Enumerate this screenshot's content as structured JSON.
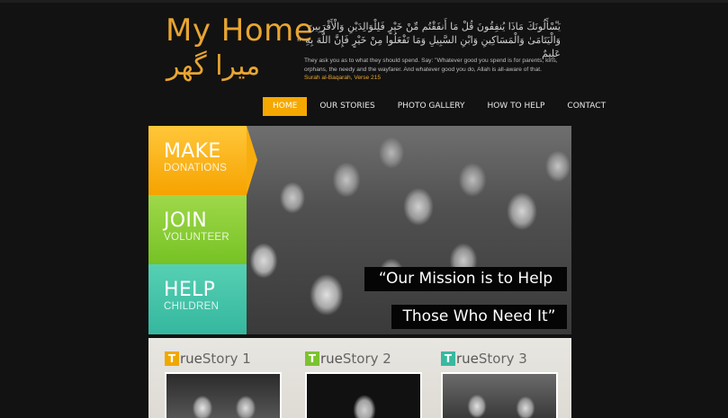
{
  "header": {
    "logo_en": "My Home",
    "logo_ur": "میرا گھر",
    "quote_arabic": "يَسْأَلُونَكَ مَاذَا يُنفِقُونَ قُلْ مَا أَنفَقْتُم مِّنْ خَيْرٍ فَلِلْوَالِدَيْنِ وَالْأَقْرَبِينَ وَالْيَتَامَىٰ وَالْمَسَاكِينِ وَابْنِ السَّبِيلِ وَمَا تَفْعَلُوا مِنْ خَيْرٍ فَإِنَّ اللَّهَ بِهِ عَلِيمٌ",
    "quote_open": "“",
    "quote_close": "”",
    "quote_english": "They ask you as to what they should spend. Say: \"Whatever good you spend is for parents, kins, orphans, the needy and the wayfarer. And whatever good you do, Allah is all-aware of that.",
    "quote_source": "Surah al-Baqarah, Verse 215"
  },
  "nav": {
    "items": [
      {
        "label": "HOME",
        "active": true
      },
      {
        "label": "OUR STORIES"
      },
      {
        "label": "PHOTO GALLERY"
      },
      {
        "label": "HOW TO HELP"
      },
      {
        "label": "CONTACT"
      }
    ]
  },
  "hero": {
    "panels": [
      {
        "big": "MAKE",
        "small": "DONATIONS",
        "color": "#f8ad0f"
      },
      {
        "big": "JOIN",
        "small": "VOLUNTEER",
        "color": "#86cc33"
      },
      {
        "big": "HELP",
        "small": "CHILDREN",
        "color": "#45c4aa"
      }
    ],
    "mission_text": "“Our Mission is to Help",
    "need_text": "Those Who Need It”"
  },
  "stories": [
    {
      "badge": "T",
      "rest_bold": "rue",
      "rest": "Story 1"
    },
    {
      "badge": "T",
      "rest_bold": "rue",
      "rest": "Story 2"
    },
    {
      "badge": "T",
      "rest_bold": "rue",
      "rest": "Story 3"
    }
  ],
  "colors": {
    "accent_orange": "#f5a800",
    "accent_green": "#86cc33",
    "accent_teal": "#45c4aa",
    "background": "#121212"
  }
}
